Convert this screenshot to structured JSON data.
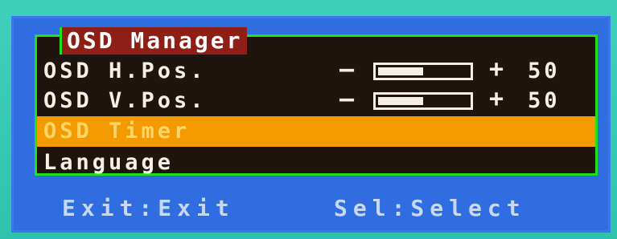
{
  "menu": {
    "title": "OSD Manager",
    "items": [
      {
        "label": "OSD H.Pos.",
        "minus": "—",
        "plus": "+",
        "value": "50",
        "level": 0.5
      },
      {
        "label": "OSD V.Pos.",
        "minus": "—",
        "plus": "+",
        "value": "50",
        "level": 0.5
      },
      {
        "label": "OSD Timer",
        "selected": true
      },
      {
        "label": "Language"
      }
    ]
  },
  "footer": {
    "exit_label": "Exit:Exit",
    "select_label": "Sel:Select"
  },
  "colors": {
    "background": "#3cc8b4",
    "osd_frame": "#2f6de0",
    "panel_bg": "#20150e",
    "panel_border": "#1fe01a",
    "title_bg": "#8e1f16",
    "highlight": "#f39a00"
  }
}
